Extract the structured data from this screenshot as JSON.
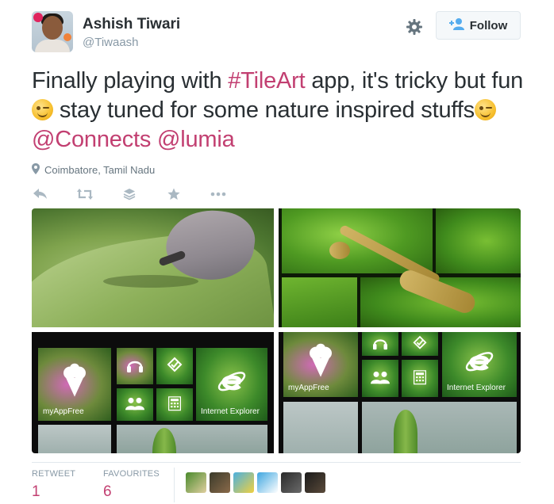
{
  "user": {
    "name": "Ashish Tiwari",
    "handle": "@Tiwaash"
  },
  "follow_label": "Follow",
  "tweet": {
    "part1": "Finally playing with ",
    "hashtag": "#TileArt",
    "part2": " app, it's tricky but fun ",
    "part3": " stay tuned for some nature inspired stuffs",
    "mention1": "@Connects",
    "mention2": "@lumia"
  },
  "location": "Coimbatore, Tamil Nadu",
  "actions": [
    "reply-icon",
    "retweet-icon",
    "buffer-icon",
    "favorite-icon",
    "more-icon"
  ],
  "tiles": {
    "app1": "myAppFree",
    "app2": "Internet Explorer"
  },
  "stats": {
    "retweet_label": "RETWEET",
    "retweet_value": "1",
    "favourites_label": "FAVOURITES",
    "favourites_value": "6"
  },
  "colors": {
    "link": "#c23f71",
    "text": "#292f33",
    "muted": "#8899a6"
  },
  "favouriter_avatars": [
    "avatar-1",
    "avatar-2",
    "avatar-3",
    "avatar-4",
    "avatar-5",
    "avatar-6"
  ]
}
